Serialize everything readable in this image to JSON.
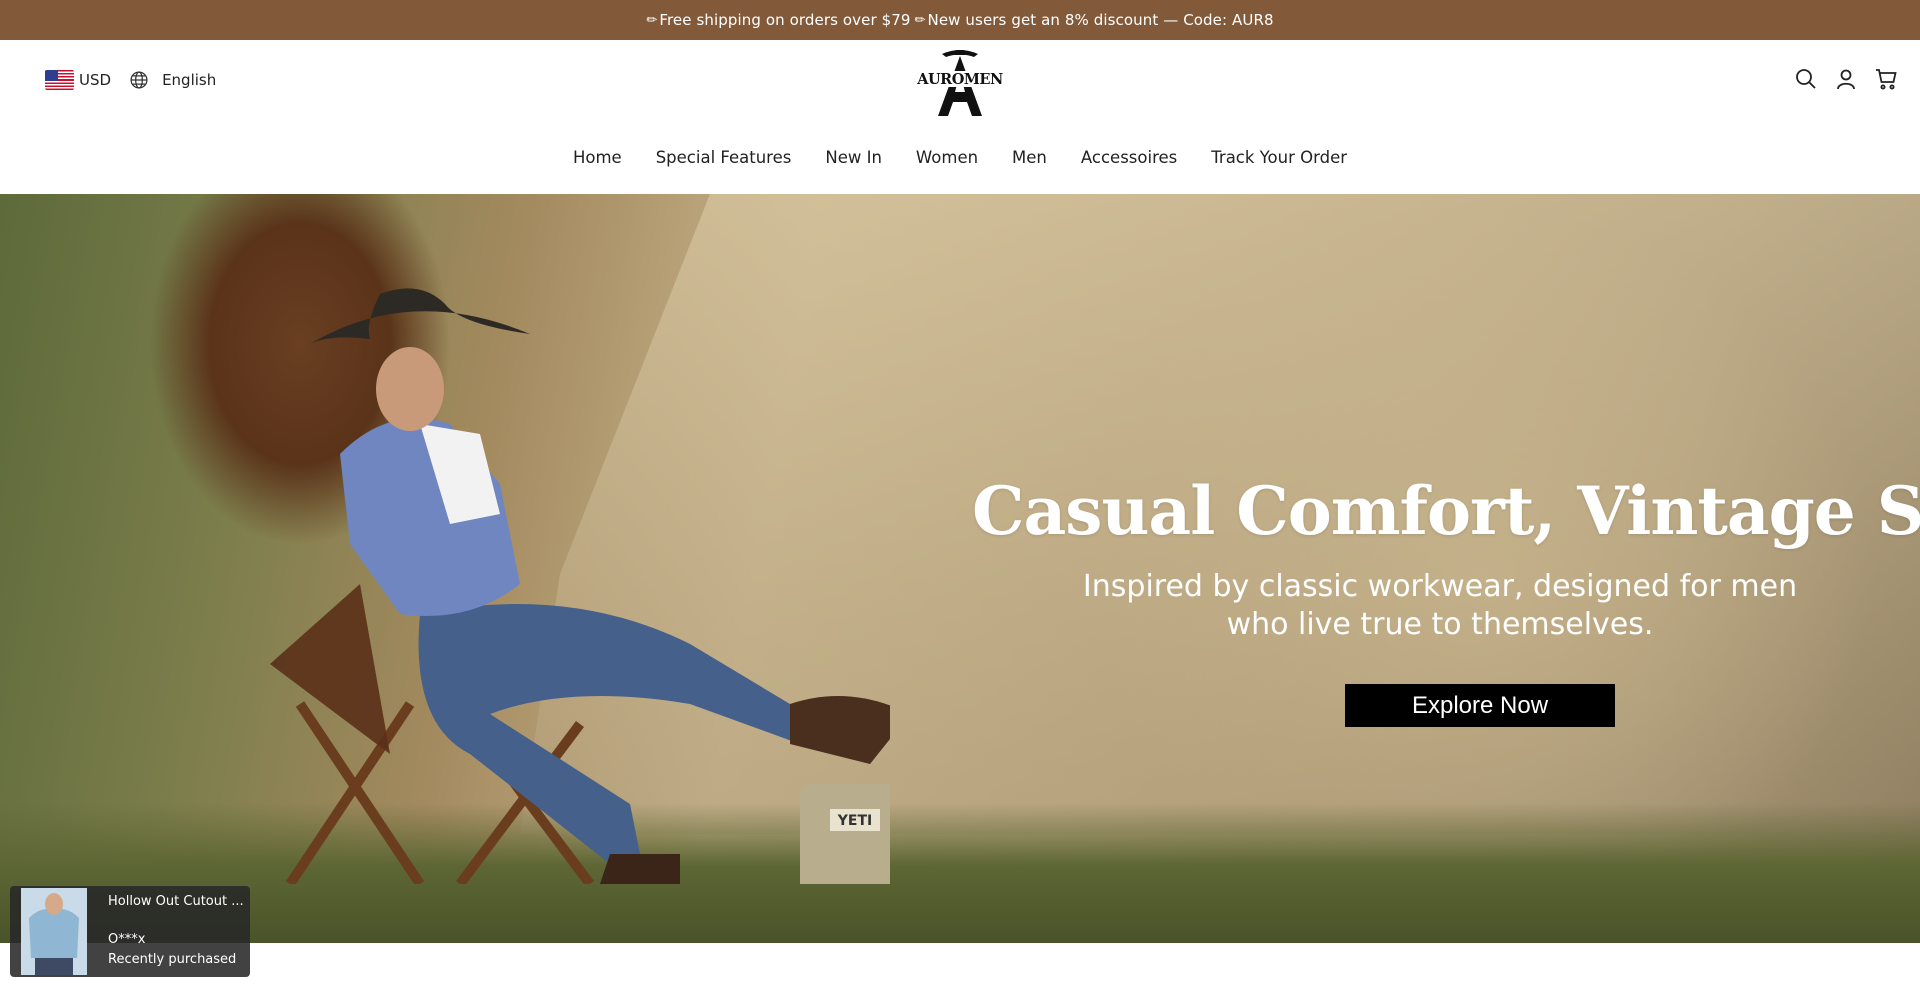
{
  "announcement": {
    "icon": "pen-icon",
    "text1": "Free shipping on orders over $79",
    "text2": "New users get an 8% discount — Code: AUR8"
  },
  "header": {
    "currency": "USD",
    "language": "English",
    "logo_text": "AUROMEN",
    "icons": [
      "search-icon",
      "account-icon",
      "cart-icon"
    ]
  },
  "nav": {
    "items": [
      "Home",
      "Special Features",
      "New In",
      "Women",
      "Men",
      "Accessoires",
      "Track Your Order"
    ]
  },
  "hero": {
    "headline": "Casual Comfort, Vintage Soul.",
    "subline1": "Inspired by classic workwear, designed for men",
    "subline2": "who live true to themselves.",
    "cta_label": "Explore Now",
    "cooler_text": "YETI"
  },
  "purchase_popup": {
    "product_name": "Hollow Out Cutout ...",
    "buyer": "O***x",
    "status": "Recently purchased"
  },
  "colors": {
    "announcement_bg": "#825a3a",
    "cta_bg": "#000000"
  }
}
